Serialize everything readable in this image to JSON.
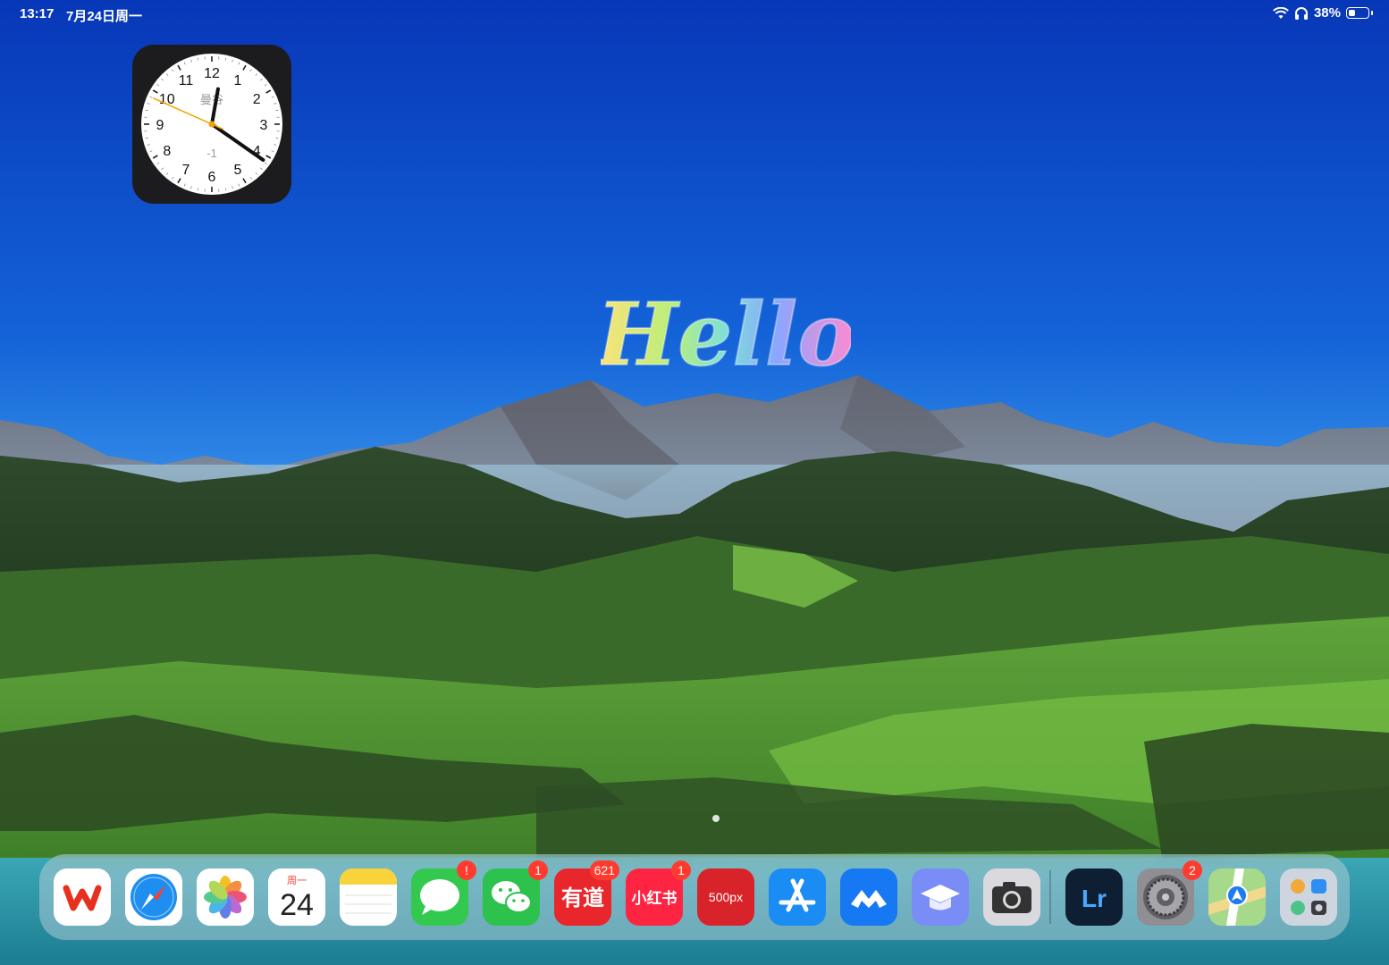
{
  "status_bar": {
    "time": "13:17",
    "date": "7月24日周一",
    "battery_percent": "38%",
    "battery_level": 0.38
  },
  "clock_widget": {
    "city": "曼谷",
    "offset": "-1",
    "numbers": [
      "12",
      "1",
      "2",
      "3",
      "4",
      "5",
      "6",
      "7",
      "8",
      "9",
      "10",
      "11"
    ],
    "time_shown": "12:20:49"
  },
  "wallpaper": {
    "greeting": "Hello",
    "sky_top": "#0b3fc4",
    "sky_bottom": "#4aa6ee"
  },
  "dock": {
    "apps": [
      {
        "name": "WPS Office",
        "icon": "wps-icon"
      },
      {
        "name": "Safari",
        "icon": "safari-icon"
      },
      {
        "name": "Photos",
        "icon": "photos-icon"
      },
      {
        "name": "Calendar",
        "icon": "calendar-icon",
        "weekday": "周一",
        "day": "24"
      },
      {
        "name": "Notes",
        "icon": "notes-icon"
      },
      {
        "name": "Messages",
        "icon": "messages-icon",
        "badge": "!"
      },
      {
        "name": "WeChat",
        "icon": "wechat-icon",
        "badge": "1"
      },
      {
        "name": "Youdao",
        "icon": "youdao-icon",
        "label": "有道",
        "badge": "621"
      },
      {
        "name": "Xiaohongshu",
        "icon": "xiaohongshu-icon",
        "label": "小红书",
        "badge": "1"
      },
      {
        "name": "500px",
        "icon": "500px-icon",
        "label": "500px"
      },
      {
        "name": "App Store",
        "icon": "app-store-icon"
      },
      {
        "name": "Tencent Meeting",
        "icon": "meeting-icon"
      },
      {
        "name": "Education",
        "icon": "graduation-cap-icon"
      },
      {
        "name": "Camera",
        "icon": "camera-icon"
      },
      {
        "name": "Lightroom",
        "icon": "lightroom-icon",
        "label": "Lr"
      },
      {
        "name": "Settings",
        "icon": "settings-icon",
        "badge": "2"
      },
      {
        "name": "Maps",
        "icon": "maps-icon"
      },
      {
        "name": "Recent Apps Folder",
        "icon": "app-folder-icon"
      }
    ]
  }
}
